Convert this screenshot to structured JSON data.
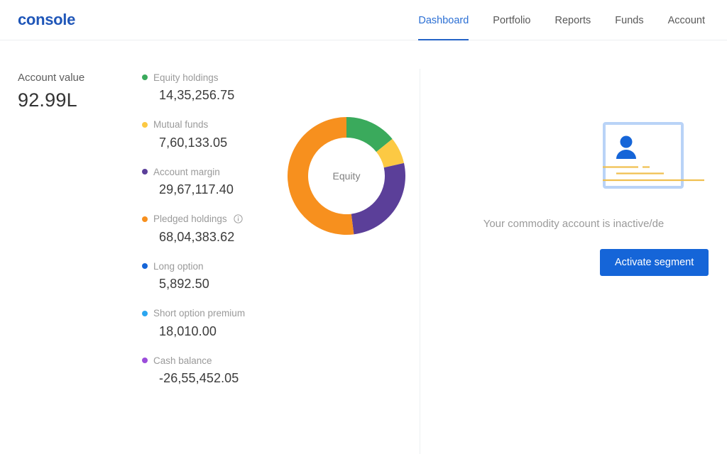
{
  "brand": {
    "name": "console"
  },
  "nav": {
    "items": [
      {
        "label": "Dashboard",
        "active": true
      },
      {
        "label": "Portfolio",
        "active": false
      },
      {
        "label": "Reports",
        "active": false
      },
      {
        "label": "Funds",
        "active": false
      },
      {
        "label": "Account",
        "active": false
      }
    ]
  },
  "account": {
    "label": "Account value",
    "value": "92.99L"
  },
  "legend": {
    "items": [
      {
        "label": "Equity holdings",
        "value": "14,35,256.75",
        "color": "#3aaa5c",
        "info": false
      },
      {
        "label": "Mutual funds",
        "value": "7,60,133.05",
        "color": "#fcc943",
        "info": false
      },
      {
        "label": "Account margin",
        "value": "29,67,117.40",
        "color": "#5b3f99",
        "info": false
      },
      {
        "label": "Pledged holdings",
        "value": "68,04,383.62",
        "color": "#f7901e",
        "info": true,
        "info_icon": "info-circle-icon"
      },
      {
        "label": "Long option",
        "value": "5,892.50",
        "color": "#1565d8",
        "info": false
      },
      {
        "label": "Short option premium",
        "value": "18,010.00",
        "color": "#2ba6f0",
        "info": false
      },
      {
        "label": "Cash balance",
        "value": "-26,55,452.05",
        "color": "#9b4dda",
        "info": false
      }
    ]
  },
  "chart_data": {
    "type": "pie",
    "title": "",
    "center_label": "Equity",
    "donut": true,
    "legend_position": "left",
    "categories": [
      "Equity holdings",
      "Mutual funds",
      "Account margin",
      "Pledged holdings"
    ],
    "values": [
      14.2,
      7.3,
      26.5,
      52.0
    ],
    "value_unit": "percent",
    "colors": [
      "#3aaa5c",
      "#fcc943",
      "#5b3f99",
      "#f7901e"
    ],
    "start_angle_deg": -90
  },
  "promo": {
    "illustration": "id-card-icon",
    "message": "Your commodity account is inactive/de",
    "button_label": "Activate segment",
    "button_color": "#1565d8"
  }
}
